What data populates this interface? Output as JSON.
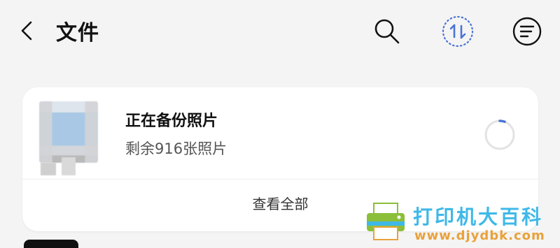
{
  "header": {
    "title": "文件",
    "back_icon": "chevron-left-icon",
    "search_icon": "search-icon",
    "sync_icon": "sync-arrows-icon",
    "menu_icon": "menu-circle-icon"
  },
  "backup_card": {
    "title": "正在备份照片",
    "subtitle": "剩余916张照片",
    "view_all": "查看全部",
    "accent_color": "#4a74d6"
  },
  "watermark": {
    "brand": "打印机大百科",
    "url": "www.djydbk.com"
  }
}
